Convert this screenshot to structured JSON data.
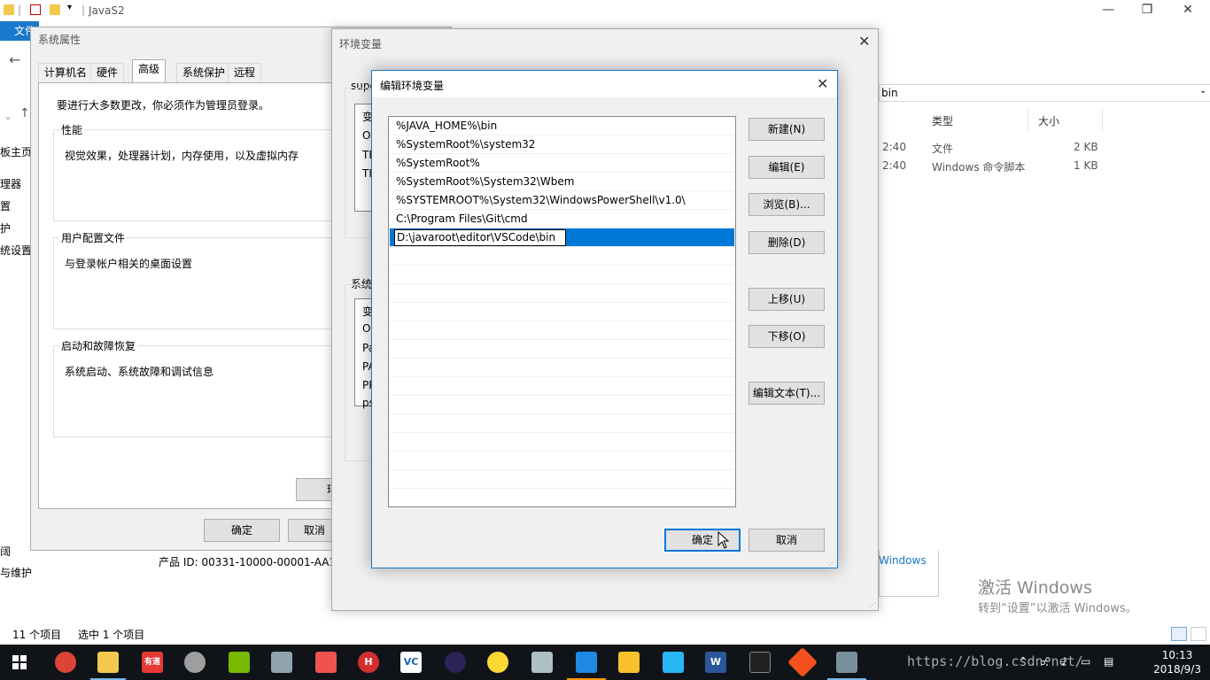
{
  "explorer": {
    "title": "JavaS2",
    "ribbon_file": "文件",
    "address_fragment": "bin",
    "nav_fragments": [
      "板主页",
      "理器",
      "置",
      "护",
      "统设置",
      "阔",
      "与维护"
    ],
    "columns": {
      "type": "类型",
      "size": "大小"
    },
    "files": [
      {
        "time": "2:40",
        "type": "文件",
        "size": "2 KB"
      },
      {
        "time": "2:40",
        "type": "Windows 命令脚本",
        "size": "1 KB"
      }
    ],
    "status": {
      "count": "11 个项目",
      "selected": "选中 1 个项目"
    },
    "windows_fragment": "Windows"
  },
  "sysprop": {
    "title": "系统属性",
    "tabs": [
      "计算机名",
      "硬件",
      "高级",
      "系统保护",
      "远程"
    ],
    "admin_note": "要进行大多数更改，你必须作为管理员登录。",
    "groups": [
      {
        "title": "性能",
        "desc": "视觉效果，处理器计划，内存使用，以及虚拟内存"
      },
      {
        "title": "用户配置文件",
        "desc": "与登录帐户相关的桌面设置"
      },
      {
        "title": "启动和故障恢复",
        "desc": "系统启动、系统故障和调试信息"
      }
    ],
    "env_btn_fragment": "环",
    "ok": "确定",
    "cancel_fragment": "取消",
    "product_id": "产品 ID: 00331-10000-00001-AA17"
  },
  "envvar": {
    "title": "环境变量",
    "user_group_fragment": "supe",
    "user_rows": [
      "变",
      "O",
      "TE",
      "TI"
    ],
    "sys_group_fragment": "系统",
    "sys_rows": [
      "变",
      "O",
      "Pa",
      "PA",
      "PR",
      "ps"
    ]
  },
  "editdlg": {
    "title": "编辑环境变量",
    "entries": [
      "%JAVA_HOME%\\bin",
      "%SystemRoot%\\system32",
      "%SystemRoot%",
      "%SystemRoot%\\System32\\Wbem",
      "%SYSTEMROOT%\\System32\\WindowsPowerShell\\v1.0\\",
      "C:\\Program Files\\Git\\cmd"
    ],
    "editing_value": "D:\\javaroot\\editor\\VSCode\\bin",
    "buttons": {
      "new": "新建(N)",
      "edit": "编辑(E)",
      "browse": "浏览(B)...",
      "delete": "删除(D)",
      "move_up": "上移(U)",
      "move_down": "下移(O)",
      "edit_text": "编辑文本(T)...",
      "ok": "确定",
      "cancel": "取消"
    }
  },
  "watermark": {
    "line1": "激活 Windows",
    "line2": "转到“设置”以激活 Windows。",
    "url": "https://blog.csdn.net/"
  },
  "taskbar": {
    "time": "10:13",
    "date": "2018/9/3",
    "icons": [
      "chrome-icon",
      "file-explorer-icon",
      "youdao-icon",
      "tool-icon",
      "nvidia-icon",
      "control-icon",
      "app-icon",
      "h-app-icon",
      "vc-icon",
      "eclipse-icon",
      "app2-icon",
      "app3-icon",
      "app4-icon",
      "app5-icon",
      "app6-icon",
      "word-icon",
      "cmd-icon",
      "git-icon",
      "system-icon"
    ],
    "icon_labels": [
      "有道",
      "H",
      "VC",
      "W"
    ]
  },
  "colors": {
    "accent": "#0078d7",
    "taskbar": "#101418",
    "dialog_bg": "#f0f0f0"
  }
}
